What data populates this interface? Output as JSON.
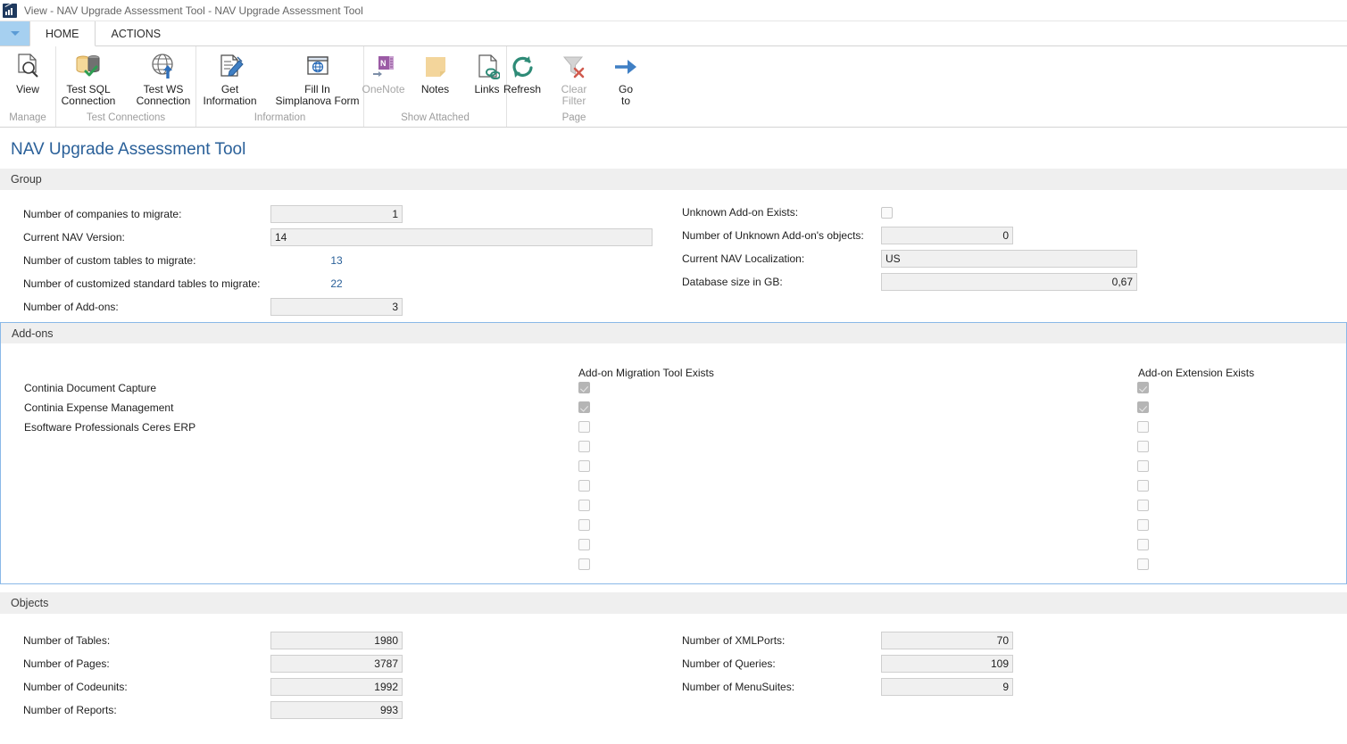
{
  "window": {
    "icon": "chart-app-icon",
    "title": "View - NAV Upgrade Assessment Tool - NAV Upgrade Assessment Tool"
  },
  "tabs": {
    "app_button_icon": "chevron-down-icon",
    "items": [
      {
        "label": "HOME",
        "active": true
      },
      {
        "label": "ACTIONS",
        "active": false
      }
    ]
  },
  "ribbon": {
    "groups": [
      {
        "label": "Manage",
        "buttons": [
          {
            "label": "View",
            "icon": "page-search-icon",
            "disabled": false
          }
        ]
      },
      {
        "label": "Test Connections",
        "buttons": [
          {
            "label": "Test SQL\nConnection",
            "icon": "database-check-icon",
            "disabled": false
          },
          {
            "label": "Test WS\nConnection",
            "icon": "globe-arrow-icon",
            "disabled": false
          }
        ]
      },
      {
        "label": "Information",
        "buttons": [
          {
            "label": "Get\nInformation",
            "icon": "document-pencil-icon",
            "disabled": false
          },
          {
            "label": "Fill In\nSimplanova Form",
            "icon": "web-form-icon",
            "disabled": false
          }
        ]
      },
      {
        "label": "Show Attached",
        "buttons": [
          {
            "label": "OneNote",
            "icon": "onenote-icon",
            "disabled": true
          },
          {
            "label": "Notes",
            "icon": "note-icon",
            "disabled": false
          },
          {
            "label": "Links",
            "icon": "links-icon",
            "disabled": false
          }
        ]
      },
      {
        "label": "Page",
        "buttons": [
          {
            "label": "Refresh",
            "icon": "refresh-icon",
            "disabled": false
          },
          {
            "label": "Clear\nFilter",
            "icon": "clear-filter-icon",
            "disabled": true
          },
          {
            "label": "Go\nto",
            "icon": "arrow-right-icon",
            "disabled": false
          }
        ]
      }
    ]
  },
  "page": {
    "title": "NAV Upgrade Assessment Tool"
  },
  "group_section": {
    "header": "Group",
    "left_fields": [
      {
        "label": "Number of companies to migrate:",
        "value": "1",
        "kind": "numbox"
      },
      {
        "label": "Current NAV Version:",
        "value": "14",
        "kind": "textbox"
      },
      {
        "label": "Number of custom tables to migrate:",
        "value": "13",
        "kind": "link"
      },
      {
        "label": "Number of customized standard tables to migrate:",
        "value": "22",
        "kind": "link"
      },
      {
        "label": "Number of Add-ons:",
        "value": "3",
        "kind": "numbox"
      }
    ],
    "right_fields": [
      {
        "label": "Unknown Add-on Exists:",
        "value": "",
        "kind": "checkbox",
        "checked": false
      },
      {
        "label": "Number of Unknown Add-on's objects:",
        "value": "0",
        "kind": "numbox"
      },
      {
        "label": "Current NAV Localization:",
        "value": "US",
        "kind": "textbox"
      },
      {
        "label": "Database size in GB:",
        "value": "0,67",
        "kind": "numbox"
      }
    ]
  },
  "addons_section": {
    "header": "Add-ons",
    "column_headers": {
      "migration_tool": "Add-on Migration Tool Exists",
      "extension": "Add-on Extension Exists"
    },
    "rows": [
      {
        "name": "Continia Document Capture",
        "migration_tool": true,
        "extension": true
      },
      {
        "name": "Continia Expense Management",
        "migration_tool": true,
        "extension": true
      },
      {
        "name": "Esoftware Professionals Ceres ERP",
        "migration_tool": false,
        "extension": false
      },
      {
        "name": "",
        "migration_tool": false,
        "extension": false
      },
      {
        "name": "",
        "migration_tool": false,
        "extension": false
      },
      {
        "name": "",
        "migration_tool": false,
        "extension": false
      },
      {
        "name": "",
        "migration_tool": false,
        "extension": false
      },
      {
        "name": "",
        "migration_tool": false,
        "extension": false
      },
      {
        "name": "",
        "migration_tool": false,
        "extension": false
      },
      {
        "name": "",
        "migration_tool": false,
        "extension": false
      }
    ]
  },
  "objects_section": {
    "header": "Objects",
    "left_fields": [
      {
        "label": "Number of Tables:",
        "value": "1980"
      },
      {
        "label": "Number of Pages:",
        "value": "3787"
      },
      {
        "label": "Number of Codeunits:",
        "value": "1992"
      },
      {
        "label": "Number of Reports:",
        "value": "993"
      }
    ],
    "right_fields": [
      {
        "label": "Number of XMLPorts:",
        "value": "70"
      },
      {
        "label": "Number of Queries:",
        "value": "109"
      },
      {
        "label": "Number of MenuSuites:",
        "value": "9"
      }
    ]
  },
  "colors": {
    "accent": "#2a6099",
    "section_header_bg": "#efefef",
    "panel_border": "#8ab9e8",
    "field_bg": "#f0f0f0"
  }
}
